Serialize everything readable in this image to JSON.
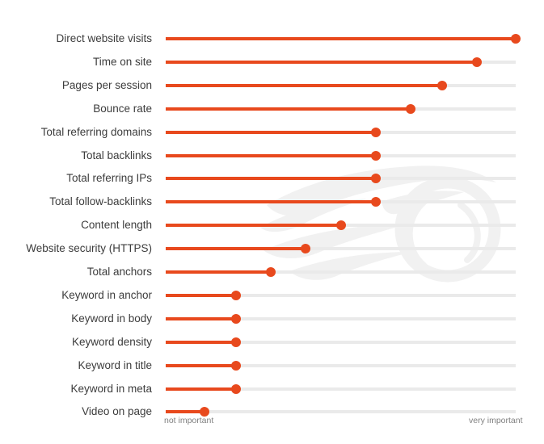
{
  "chart_data": {
    "type": "bar",
    "variant": "lollipop-horizontal",
    "title": "",
    "subtitle": "",
    "xlabel": "",
    "ylabel": "",
    "grid": false,
    "legend": null,
    "axis": {
      "left_label": "not important",
      "right_label": "very important",
      "xlim": [
        0,
        100
      ],
      "track_color": "#eaeaea",
      "fill_color": "#e8491d",
      "dot_color": "#e8491d"
    },
    "categories": [
      "Direct website visits",
      "Time on site",
      "Pages per session",
      "Bounce rate",
      "Total referring domains",
      "Total backlinks",
      "Total referring IPs",
      "Total follow-backlinks",
      "Content length",
      "Website security (HTTPS)",
      "Total anchors",
      "Keyword in anchor",
      "Keyword in body",
      "Keyword density",
      "Keyword in title",
      "Keyword in meta",
      "Video on page"
    ],
    "values": [
      100,
      89,
      79,
      70,
      60,
      60,
      60,
      60,
      50,
      40,
      30,
      20,
      20,
      20,
      20,
      20,
      11
    ]
  },
  "rows": [
    {
      "label": "Direct website visits",
      "value": 100
    },
    {
      "label": "Time on site",
      "value": 89
    },
    {
      "label": "Pages per session",
      "value": 79
    },
    {
      "label": "Bounce rate",
      "value": 70
    },
    {
      "label": "Total referring domains",
      "value": 60
    },
    {
      "label": "Total backlinks",
      "value": 60
    },
    {
      "label": "Total referring IPs",
      "value": 60
    },
    {
      "label": "Total follow-backlinks",
      "value": 60
    },
    {
      "label": "Content length",
      "value": 50
    },
    {
      "label": "Website security (HTTPS)",
      "value": 40
    },
    {
      "label": "Total anchors",
      "value": 30
    },
    {
      "label": "Keyword in anchor",
      "value": 20
    },
    {
      "label": "Keyword in body",
      "value": 20
    },
    {
      "label": "Keyword density",
      "value": 20
    },
    {
      "label": "Keyword in title",
      "value": 20
    },
    {
      "label": "Keyword in meta",
      "value": 20
    },
    {
      "label": "Video on page",
      "value": 11
    }
  ],
  "axis_captions": {
    "left": "not important",
    "right": "very important"
  },
  "colors": {
    "accent": "#e8491d",
    "track": "#eaeaea",
    "label_text": "#3c3c3c",
    "caption_text": "#808080",
    "background": "#ffffff",
    "watermark": "#f2f2f2"
  },
  "watermark": {
    "name": "flame-wing-logo-watermark"
  }
}
